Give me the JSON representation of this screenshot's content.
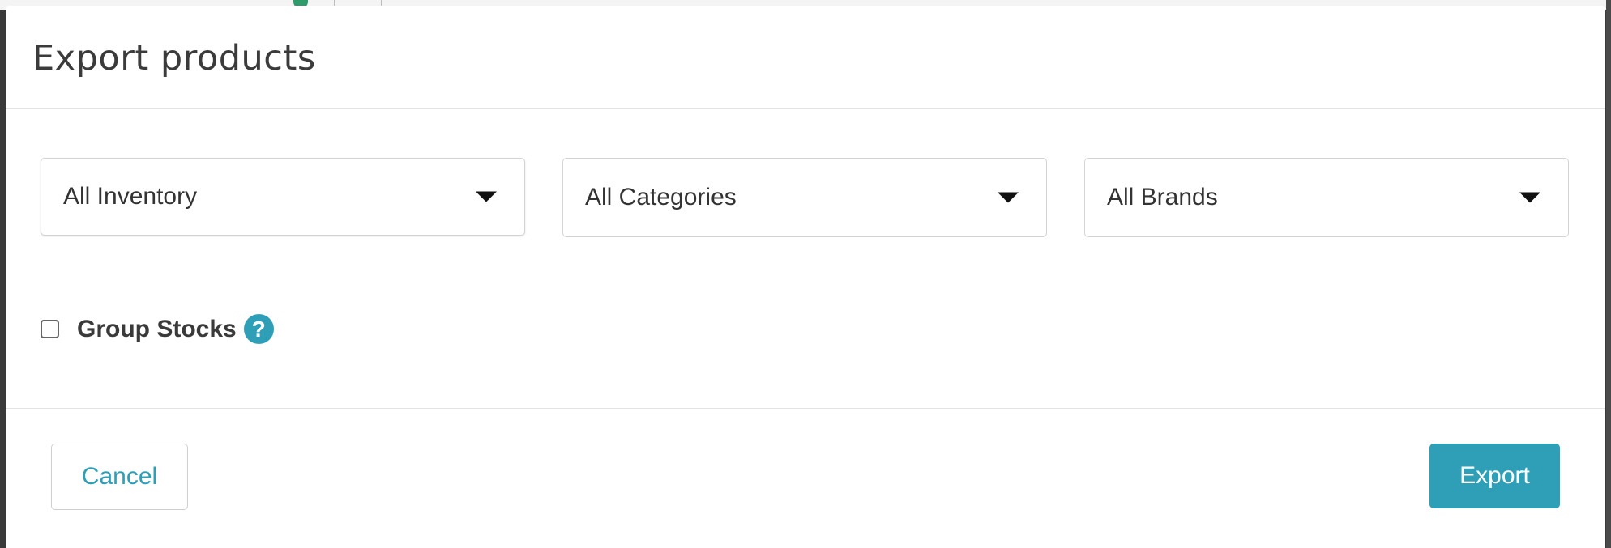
{
  "modal": {
    "title": "Export products"
  },
  "filters": {
    "inventory": {
      "selected": "All Inventory"
    },
    "categories": {
      "selected": "All Categories"
    },
    "brands": {
      "selected": "All Brands"
    }
  },
  "options": {
    "group_stocks": {
      "label": "Group Stocks",
      "checked": false,
      "help_icon": "?"
    }
  },
  "footer": {
    "cancel_label": "Cancel",
    "export_label": "Export"
  },
  "colors": {
    "accent": "#2f9fb7",
    "text": "#333333",
    "border": "#d3d3d3"
  }
}
